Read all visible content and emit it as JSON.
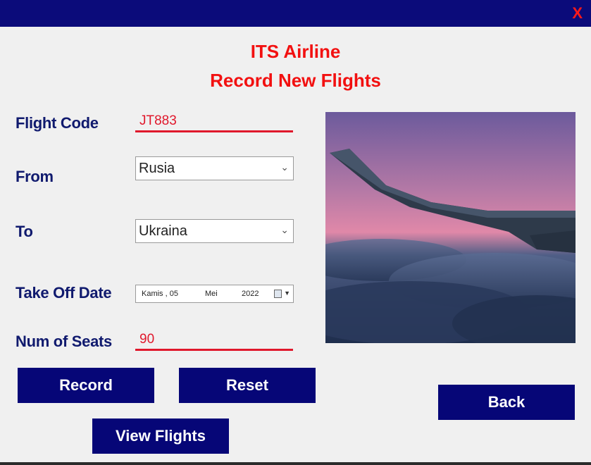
{
  "window": {
    "close_label": "X"
  },
  "header": {
    "title": "ITS Airline",
    "subtitle": "Record New Flights"
  },
  "form": {
    "flight_code_label": "Flight Code",
    "flight_code_value": "JT883",
    "from_label": "From",
    "from_value": "Rusia",
    "to_label": "To",
    "to_value": "Ukraina",
    "date_label": "Take Off Date",
    "date_day": "Kamis , 05",
    "date_month": "Mei",
    "date_year": "2022",
    "seats_label": "Num of Seats",
    "seats_value": "90"
  },
  "buttons": {
    "record": "Record",
    "reset": "Reset",
    "back": "Back",
    "view_flights": "View Flights"
  },
  "colors": {
    "title_bar": "#0b0b7a",
    "heading": "#f21010",
    "label": "#101a6e",
    "button": "#060677",
    "accent_line": "#e0182c"
  },
  "icons": {
    "combo_arrow": "chevron-down-icon",
    "date_picker": "calendar-icon"
  }
}
